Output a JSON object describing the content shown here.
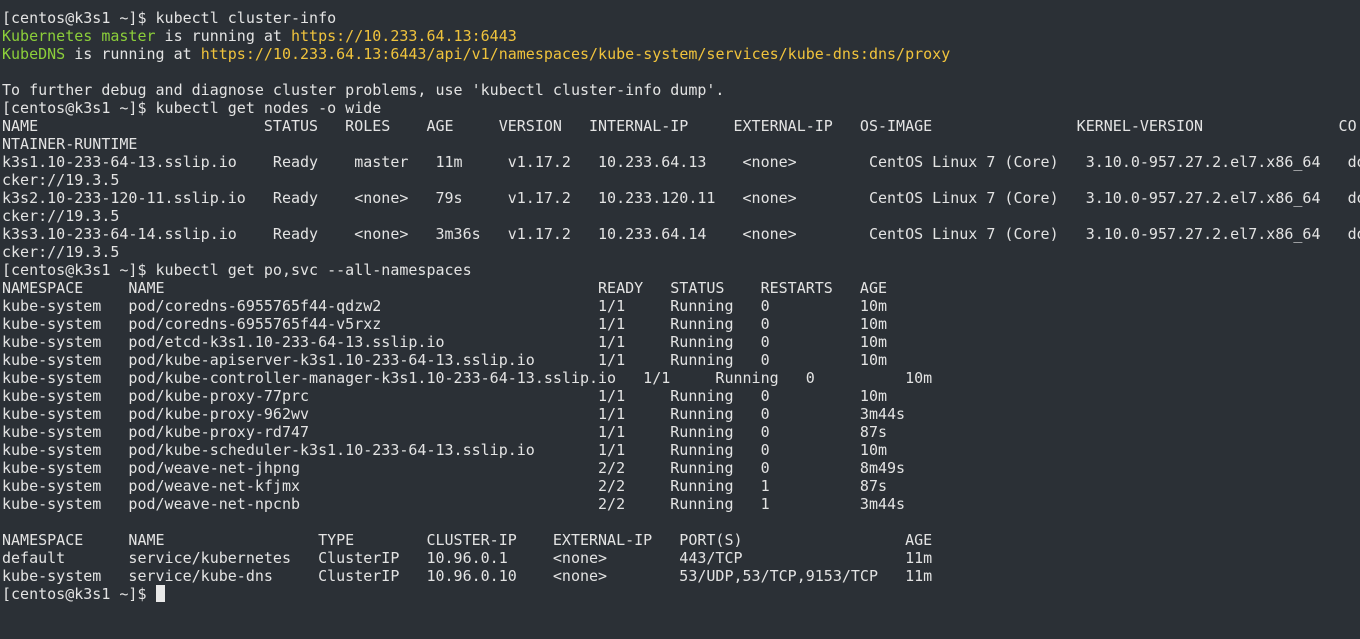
{
  "terminal": {
    "lines": [
      [
        {
          "t": "[centos@k3s1 ~]$ kubectl cluster-info"
        }
      ],
      [
        {
          "t": "Kubernetes master",
          "c": "green"
        },
        {
          "t": " is running at "
        },
        {
          "t": "https://10.233.64.13:6443",
          "c": "yellow"
        }
      ],
      [
        {
          "t": "KubeDNS",
          "c": "green"
        },
        {
          "t": " is running at "
        },
        {
          "t": "https://10.233.64.13:6443/api/v1/namespaces/kube-system/services/kube-dns:dns/proxy",
          "c": "yellow"
        }
      ],
      [
        {
          "t": ""
        }
      ],
      [
        {
          "t": "To further debug and diagnose cluster problems, use 'kubectl cluster-info dump'."
        }
      ],
      [
        {
          "t": "[centos@k3s1 ~]$ kubectl get nodes -o wide"
        }
      ],
      [
        {
          "t": "NAME                         STATUS   ROLES    AGE     VERSION   INTERNAL-IP     EXTERNAL-IP   OS-IMAGE                KERNEL-VERSION               CO"
        }
      ],
      [
        {
          "t": "NTAINER-RUNTIME"
        }
      ],
      [
        {
          "t": "k3s1.10-233-64-13.sslip.io    Ready    master   11m     v1.17.2   10.233.64.13    <none>        CentOS Linux 7 (Core)   3.10.0-957.27.2.el7.x86_64   do"
        }
      ],
      [
        {
          "t": "cker://19.3.5"
        }
      ],
      [
        {
          "t": "k3s2.10-233-120-11.sslip.io   Ready    <none>   79s     v1.17.2   10.233.120.11   <none>        CentOS Linux 7 (Core)   3.10.0-957.27.2.el7.x86_64   do"
        }
      ],
      [
        {
          "t": "cker://19.3.5"
        }
      ],
      [
        {
          "t": "k3s3.10-233-64-14.sslip.io    Ready    <none>   3m36s   v1.17.2   10.233.64.14    <none>        CentOS Linux 7 (Core)   3.10.0-957.27.2.el7.x86_64   do"
        }
      ],
      [
        {
          "t": "cker://19.3.5"
        }
      ],
      [
        {
          "t": "[centos@k3s1 ~]$ kubectl get po,svc --all-namespaces"
        }
      ],
      [
        {
          "t": "NAMESPACE     NAME                                                READY   STATUS    RESTARTS   AGE"
        }
      ],
      [
        {
          "t": "kube-system   pod/coredns-6955765f44-qdzw2                        1/1     Running   0          10m"
        }
      ],
      [
        {
          "t": "kube-system   pod/coredns-6955765f44-v5rxz                        1/1     Running   0          10m"
        }
      ],
      [
        {
          "t": "kube-system   pod/etcd-k3s1.10-233-64-13.sslip.io                 1/1     Running   0          10m"
        }
      ],
      [
        {
          "t": "kube-system   pod/kube-apiserver-k3s1.10-233-64-13.sslip.io       1/1     Running   0          10m"
        }
      ],
      [
        {
          "t": "kube-system   pod/kube-controller-manager-k3s1.10-233-64-13.sslip.io   1/1     Running   0          10m"
        }
      ],
      [
        {
          "t": "kube-system   pod/kube-proxy-77prc                                1/1     Running   0          10m"
        }
      ],
      [
        {
          "t": "kube-system   pod/kube-proxy-962wv                                1/1     Running   0          3m44s"
        }
      ],
      [
        {
          "t": "kube-system   pod/kube-proxy-rd747                                1/1     Running   0          87s"
        }
      ],
      [
        {
          "t": "kube-system   pod/kube-scheduler-k3s1.10-233-64-13.sslip.io       1/1     Running   0          10m"
        }
      ],
      [
        {
          "t": "kube-system   pod/weave-net-jhpng                                 2/2     Running   0          8m49s"
        }
      ],
      [
        {
          "t": "kube-system   pod/weave-net-kfjmx                                 2/2     Running   1          87s"
        }
      ],
      [
        {
          "t": "kube-system   pod/weave-net-npcnb                                 2/2     Running   1          3m44s"
        }
      ],
      [
        {
          "t": ""
        }
      ],
      [
        {
          "t": "NAMESPACE     NAME                 TYPE        CLUSTER-IP    EXTERNAL-IP   PORT(S)                  AGE"
        }
      ],
      [
        {
          "t": "default       service/kubernetes   ClusterIP   10.96.0.1     <none>        443/TCP                  11m"
        }
      ],
      [
        {
          "t": "kube-system   service/kube-dns     ClusterIP   10.96.0.10    <none>        53/UDP,53/TCP,9153/TCP   11m"
        }
      ]
    ],
    "prompt": "[centos@k3s1 ~]$ "
  }
}
